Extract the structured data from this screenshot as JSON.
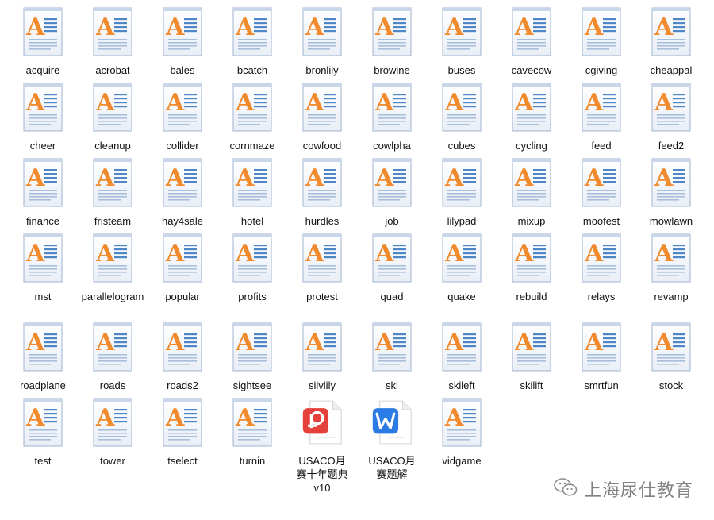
{
  "window": {
    "title": ""
  },
  "files": [
    {
      "name": "acquire",
      "icon": "wordpad-document-icon"
    },
    {
      "name": "acrobat",
      "icon": "wordpad-document-icon"
    },
    {
      "name": "bales",
      "icon": "wordpad-document-icon"
    },
    {
      "name": "bcatch",
      "icon": "wordpad-document-icon"
    },
    {
      "name": "bronlily",
      "icon": "wordpad-document-icon"
    },
    {
      "name": "browine",
      "icon": "wordpad-document-icon"
    },
    {
      "name": "buses",
      "icon": "wordpad-document-icon"
    },
    {
      "name": "cavecow",
      "icon": "wordpad-document-icon"
    },
    {
      "name": "cgiving",
      "icon": "wordpad-document-icon"
    },
    {
      "name": "cheappal",
      "icon": "wordpad-document-icon"
    },
    {
      "name": "cheer",
      "icon": "wordpad-document-icon"
    },
    {
      "name": "cleanup",
      "icon": "wordpad-document-icon"
    },
    {
      "name": "collider",
      "icon": "wordpad-document-icon"
    },
    {
      "name": "cornmaze",
      "icon": "wordpad-document-icon"
    },
    {
      "name": "cowfood",
      "icon": "wordpad-document-icon"
    },
    {
      "name": "cowlpha",
      "icon": "wordpad-document-icon"
    },
    {
      "name": "cubes",
      "icon": "wordpad-document-icon"
    },
    {
      "name": "cycling",
      "icon": "wordpad-document-icon"
    },
    {
      "name": "feed",
      "icon": "wordpad-document-icon"
    },
    {
      "name": "feed2",
      "icon": "wordpad-document-icon"
    },
    {
      "name": "finance",
      "icon": "wordpad-document-icon"
    },
    {
      "name": "fristeam",
      "icon": "wordpad-document-icon"
    },
    {
      "name": "hay4sale",
      "icon": "wordpad-document-icon"
    },
    {
      "name": "hotel",
      "icon": "wordpad-document-icon"
    },
    {
      "name": "hurdles",
      "icon": "wordpad-document-icon"
    },
    {
      "name": "job",
      "icon": "wordpad-document-icon"
    },
    {
      "name": "lilypad",
      "icon": "wordpad-document-icon"
    },
    {
      "name": "mixup",
      "icon": "wordpad-document-icon"
    },
    {
      "name": "moofest",
      "icon": "wordpad-document-icon"
    },
    {
      "name": "mowlawn",
      "icon": "wordpad-document-icon"
    },
    {
      "name": "mst",
      "icon": "wordpad-document-icon"
    },
    {
      "name": "parallelogram",
      "icon": "wordpad-document-icon"
    },
    {
      "name": "popular",
      "icon": "wordpad-document-icon"
    },
    {
      "name": "profits",
      "icon": "wordpad-document-icon"
    },
    {
      "name": "protest",
      "icon": "wordpad-document-icon"
    },
    {
      "name": "quad",
      "icon": "wordpad-document-icon"
    },
    {
      "name": "quake",
      "icon": "wordpad-document-icon"
    },
    {
      "name": "rebuild",
      "icon": "wordpad-document-icon"
    },
    {
      "name": "relays",
      "icon": "wordpad-document-icon"
    },
    {
      "name": "revamp",
      "icon": "wordpad-document-icon"
    },
    {
      "name": "roadplane",
      "icon": "wordpad-document-icon"
    },
    {
      "name": "roads",
      "icon": "wordpad-document-icon"
    },
    {
      "name": "roads2",
      "icon": "wordpad-document-icon"
    },
    {
      "name": "sightsee",
      "icon": "wordpad-document-icon"
    },
    {
      "name": "silvlily",
      "icon": "wordpad-document-icon"
    },
    {
      "name": "ski",
      "icon": "wordpad-document-icon"
    },
    {
      "name": "skileft",
      "icon": "wordpad-document-icon"
    },
    {
      "name": "skilift",
      "icon": "wordpad-document-icon"
    },
    {
      "name": "smrtfun",
      "icon": "wordpad-document-icon"
    },
    {
      "name": "stock",
      "icon": "wordpad-document-icon"
    },
    {
      "name": "test",
      "icon": "wordpad-document-icon"
    },
    {
      "name": "tower",
      "icon": "wordpad-document-icon"
    },
    {
      "name": "tselect",
      "icon": "wordpad-document-icon"
    },
    {
      "name": "turnin",
      "icon": "wordpad-document-icon"
    },
    {
      "name": "USACO月赛十年题典v10",
      "icon": "wps-pdf-document-icon"
    },
    {
      "name": "USACO月赛题解",
      "icon": "wps-word-document-icon"
    },
    {
      "name": "vidgame",
      "icon": "wordpad-document-icon"
    }
  ],
  "watermark": {
    "text": "上海尿仕教育",
    "icon": "wechat-logo-icon"
  },
  "colors": {
    "wordpad_orange": "#f08a2c",
    "wordpad_blue": "#4f86c6",
    "pdf_red": "#e5413c",
    "word_blue": "#2b7be4"
  }
}
